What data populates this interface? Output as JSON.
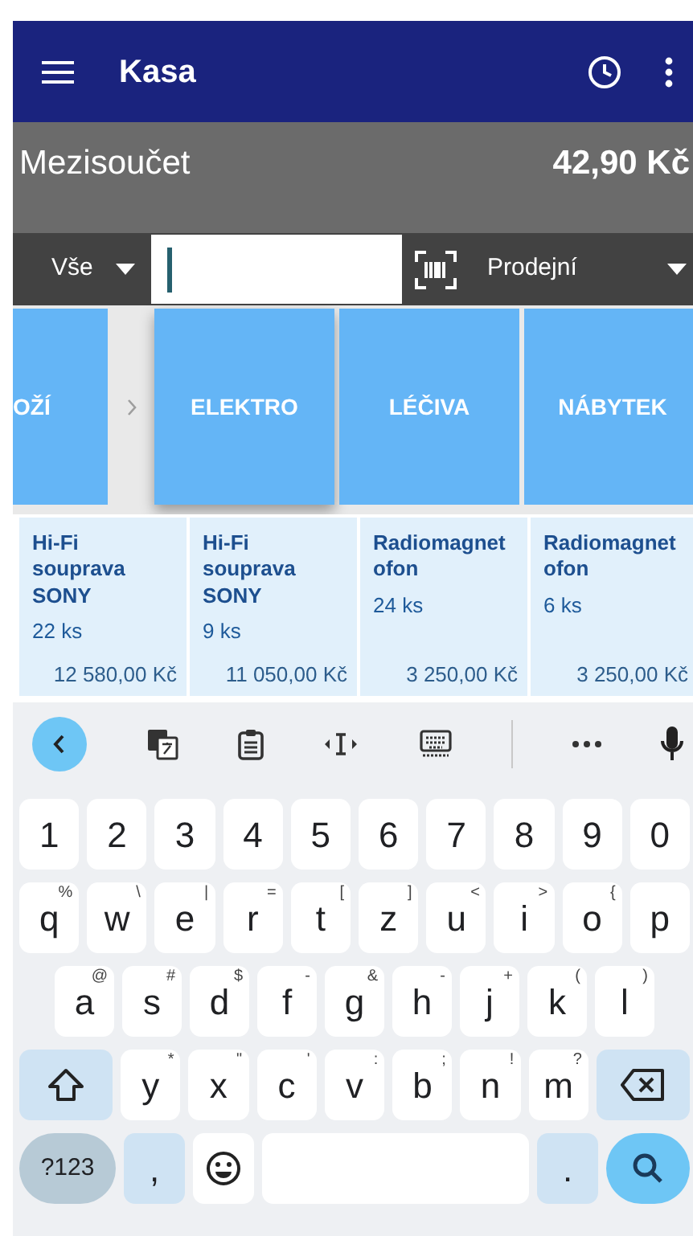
{
  "app_bar": {
    "title": "Kasa"
  },
  "subtotal": {
    "label": "Mezisoučet",
    "amount": "42,90 Kč"
  },
  "filter": {
    "category": "Vše",
    "price_list": "Prodejní"
  },
  "breadcrumb": {
    "label": "OŽÍ"
  },
  "categories": [
    "ELEKTRO",
    "LÉČIVA",
    "NÁBYTEK"
  ],
  "products": [
    {
      "name": "Hi-Fi souprava SONY",
      "stock": "22 ks",
      "price": "12 580,00 Kč"
    },
    {
      "name": "Hi-Fi souprava SONY",
      "stock": "9 ks",
      "price": "11 050,00 Kč"
    },
    {
      "name": "Radiomagnetofon",
      "stock": "24 ks",
      "price": "3 250,00 Kč"
    },
    {
      "name": "Radiomagnetofon",
      "stock": "6 ks",
      "price": "3 250,00 Kč"
    }
  ],
  "keyboard": {
    "rows": [
      [
        {
          "key": "1"
        },
        {
          "key": "2"
        },
        {
          "key": "3"
        },
        {
          "key": "4"
        },
        {
          "key": "5"
        },
        {
          "key": "6"
        },
        {
          "key": "7"
        },
        {
          "key": "8"
        },
        {
          "key": "9"
        },
        {
          "key": "0"
        }
      ],
      [
        {
          "key": "q",
          "hint": "%"
        },
        {
          "key": "w",
          "hint": "\\"
        },
        {
          "key": "e",
          "hint": "|"
        },
        {
          "key": "r",
          "hint": "="
        },
        {
          "key": "t",
          "hint": "["
        },
        {
          "key": "z",
          "hint": "]"
        },
        {
          "key": "u",
          "hint": "<"
        },
        {
          "key": "i",
          "hint": ">"
        },
        {
          "key": "o",
          "hint": "{"
        },
        {
          "key": "p"
        }
      ],
      [
        {
          "key": "a",
          "hint": "@"
        },
        {
          "key": "s",
          "hint": "#"
        },
        {
          "key": "d",
          "hint": "$"
        },
        {
          "key": "f",
          "hint": "-"
        },
        {
          "key": "g",
          "hint": "&"
        },
        {
          "key": "h",
          "hint": "-"
        },
        {
          "key": "j",
          "hint": "+"
        },
        {
          "key": "k",
          "hint": "("
        },
        {
          "key": "l",
          "hint": ")"
        }
      ],
      [
        {
          "key": "y",
          "hint": "*"
        },
        {
          "key": "x",
          "hint": "\""
        },
        {
          "key": "c",
          "hint": "'"
        },
        {
          "key": "v",
          "hint": ":"
        },
        {
          "key": "b",
          "hint": ";"
        },
        {
          "key": "n",
          "hint": "!"
        },
        {
          "key": "m",
          "hint": "?"
        }
      ]
    ],
    "symbols_key": "?123",
    "comma": ",",
    "period": "."
  }
}
